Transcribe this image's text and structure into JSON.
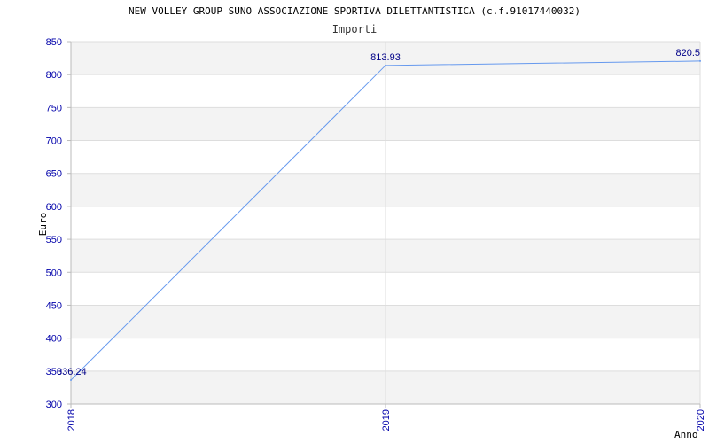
{
  "colors": {
    "band": "#f3f3f3",
    "grid": "#dddddd",
    "axis": "#bbbbbb",
    "tick_text": "#0000aa",
    "line": "#6699ee",
    "data_label": "#000088"
  },
  "chart_data": {
    "type": "line",
    "title": "NEW VOLLEY GROUP SUNO ASSOCIAZIONE SPORTIVA DILETTANTISTICA (c.f.91017440032)",
    "subtitle": "Importi",
    "xlabel": "Anno",
    "ylabel": "Euro",
    "categories": [
      "2018",
      "2019",
      "2020"
    ],
    "series": [
      {
        "values": [
          336.24,
          813.93,
          820.5
        ],
        "labels": [
          "336.24",
          "813.93",
          "820.5"
        ]
      }
    ],
    "ylim": [
      300,
      850
    ],
    "yticks": [
      300,
      350,
      400,
      450,
      500,
      550,
      600,
      650,
      700,
      750,
      800,
      850
    ],
    "grid": true,
    "legend": "none"
  }
}
